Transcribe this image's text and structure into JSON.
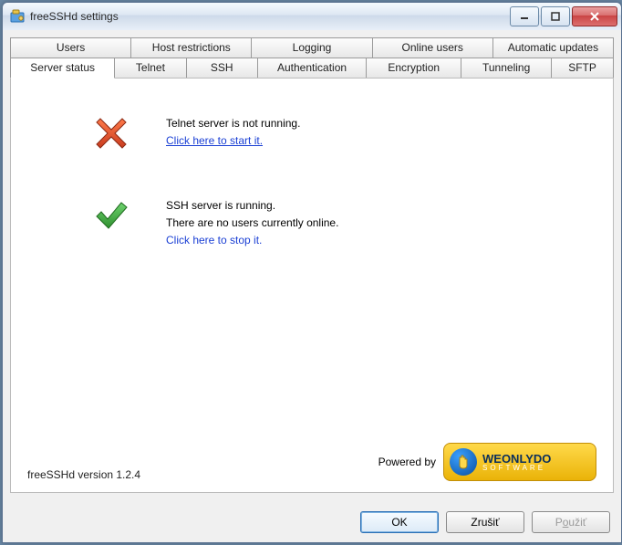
{
  "window": {
    "title": "freeSSHd settings"
  },
  "tabs_top": [
    "Users",
    "Host restrictions",
    "Logging",
    "Online users",
    "Automatic updates"
  ],
  "tabs_bottom": [
    "Server status",
    "Telnet",
    "SSH",
    "Authentication",
    "Encryption",
    "Tunneling",
    "SFTP"
  ],
  "active_tab": "Server status",
  "status": {
    "telnet": {
      "line1": "Telnet server is not running.",
      "action": "Click here to start it."
    },
    "ssh": {
      "line1": "SSH server is running.",
      "line2": "There are no users currently online.",
      "action": "Click here to stop it."
    }
  },
  "footer": {
    "version": "freeSSHd version 1.2.4",
    "powered_label": "Powered by",
    "logo_main": "WEONLYDO",
    "logo_sub": "SOFTWARE"
  },
  "buttons": {
    "ok": "OK",
    "cancel": "Zrušiť",
    "apply_prefix": "P",
    "apply_mnemonic": "o",
    "apply_suffix": "užiť"
  }
}
